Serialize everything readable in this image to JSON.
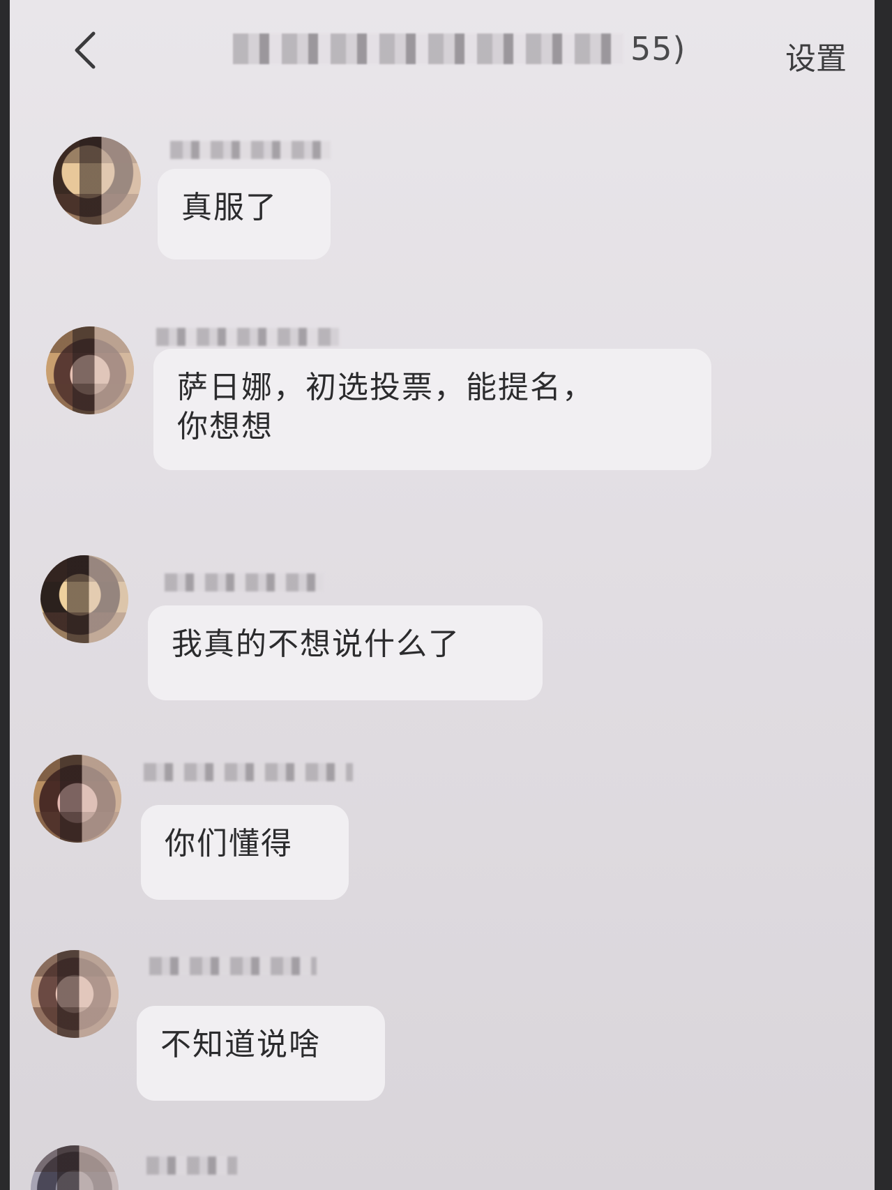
{
  "nav": {
    "title_visible": "55)",
    "settings_label": "设置"
  },
  "messages": [
    {
      "text": "真服了",
      "avatar_icon": "woman-portrait-icon"
    },
    {
      "text": "萨日娜，初选投票，能提名，\n你想想",
      "avatar_icon": "costume-portrait-icon"
    },
    {
      "text": "我真的不想说什么了",
      "avatar_icon": "woman-portrait-icon"
    },
    {
      "text": "你们懂得",
      "avatar_icon": "costume-portrait-icon"
    },
    {
      "text": "不知道说啥",
      "avatar_icon": "woman-portrait-icon"
    }
  ],
  "colors": {
    "bubble": "#f1eff2",
    "background": "#e4e0e5",
    "text": "#2b2b2d"
  }
}
